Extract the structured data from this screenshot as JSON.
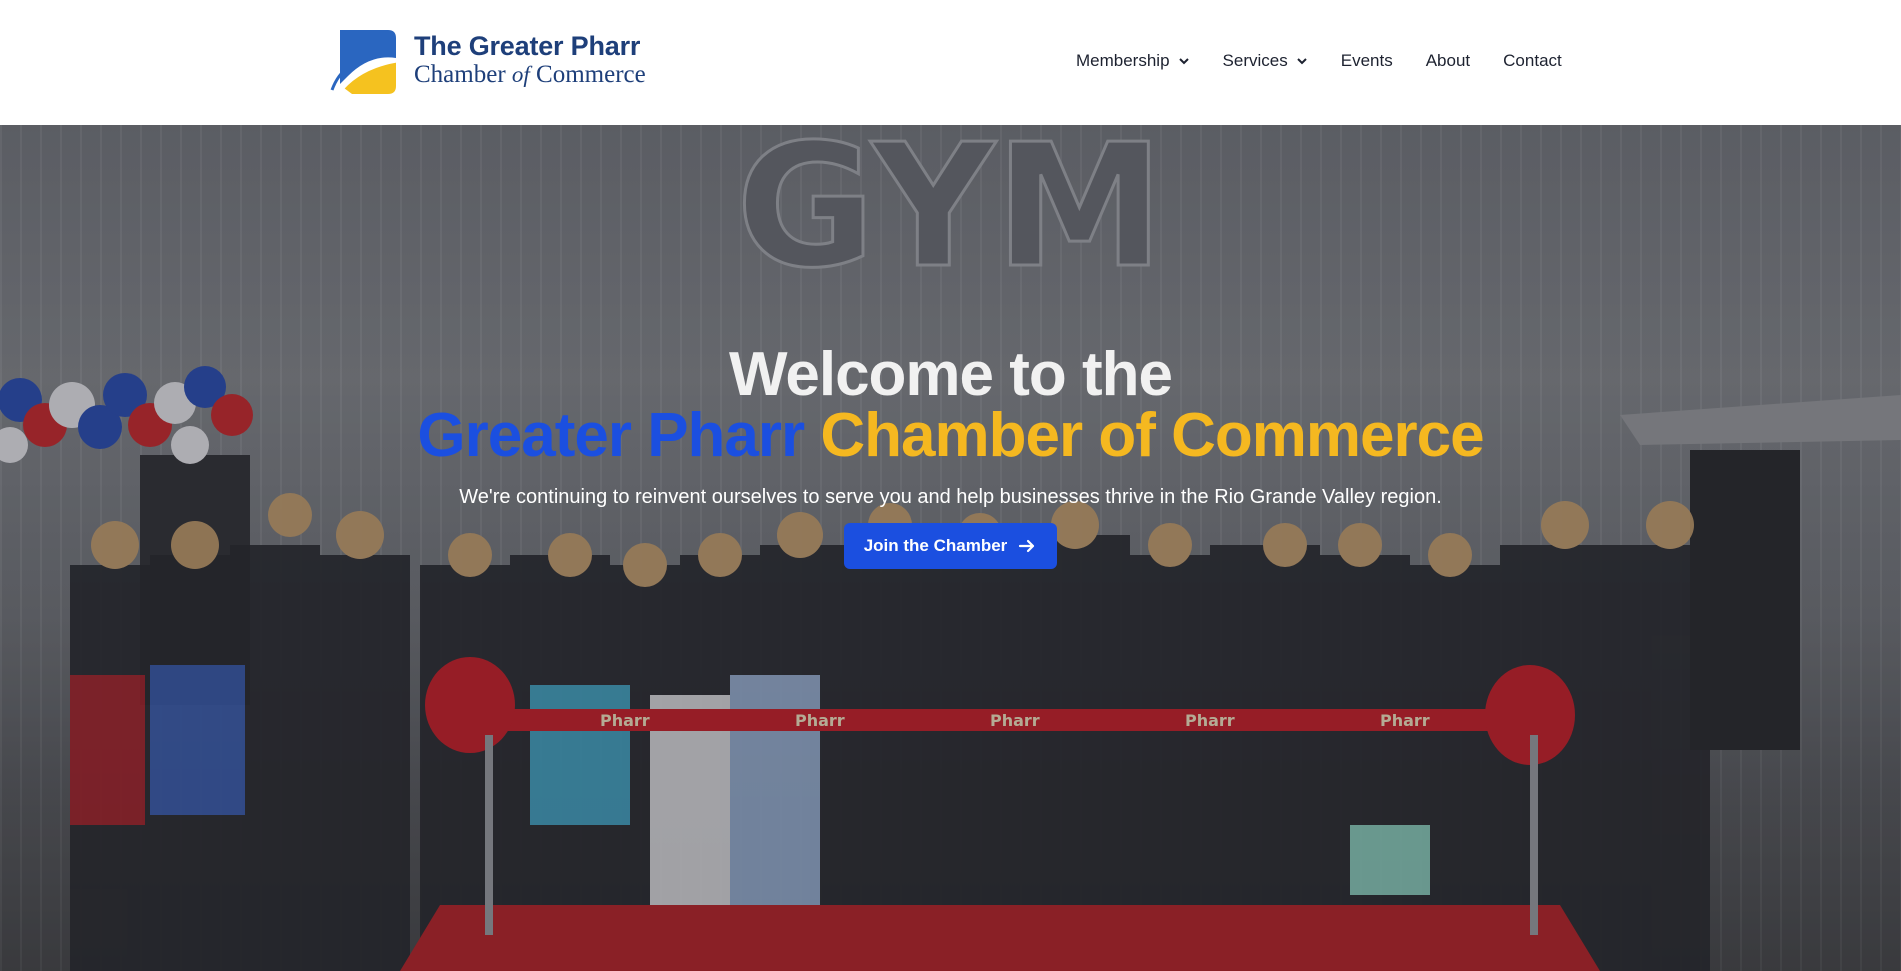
{
  "header": {
    "logo": {
      "line1": "The Greater Pharr",
      "line2_a": "Chamber",
      "line2_of": "of",
      "line2_b": "Commerce",
      "colors": {
        "navy": "#1e3f7a",
        "blue": "#1b5fb8",
        "gold": "#f5c21f"
      }
    },
    "nav": [
      {
        "label": "Membership",
        "has_dropdown": true,
        "icon": "chevron-down-icon"
      },
      {
        "label": "Services",
        "has_dropdown": true,
        "icon": "chevron-down-icon"
      },
      {
        "label": "Events",
        "has_dropdown": false
      },
      {
        "label": "About",
        "has_dropdown": false
      },
      {
        "label": "Contact",
        "has_dropdown": false
      }
    ]
  },
  "hero": {
    "building_sign": "GYM",
    "ribbon_text": "Pharr",
    "title_line1": "Welcome to the",
    "title_blue": "Greater Pharr",
    "title_gold": "Chamber of Commerce",
    "subtitle": "We're continuing to reinvent ourselves to serve you and help businesses thrive in the Rio Grande Valley region.",
    "cta_label": "Join the Chamber",
    "cta_icon": "arrow-right-icon",
    "colors": {
      "blue": "#1b4fe0",
      "gold": "#f5b820",
      "ribbon": "#c8202a"
    }
  }
}
